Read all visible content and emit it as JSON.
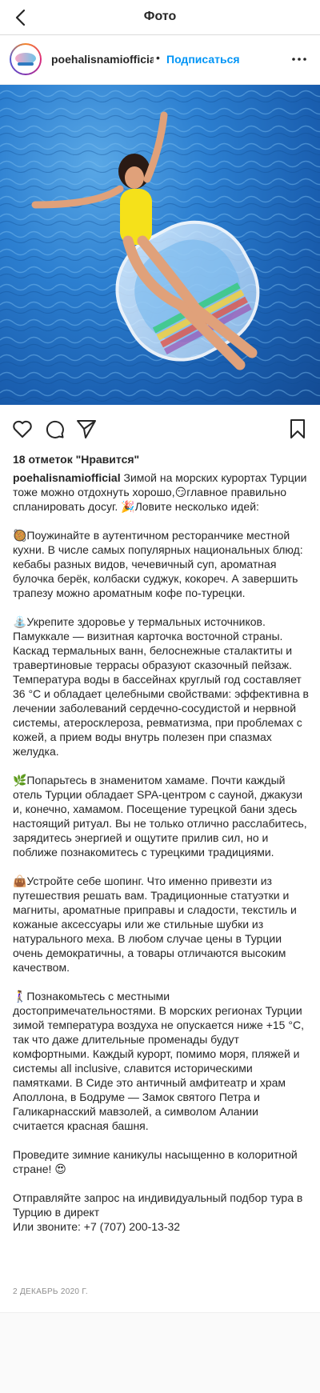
{
  "topbar": {
    "title": "Фото",
    "back_icon": "chevron-left-icon"
  },
  "post_header": {
    "username": "poehalisnamiofficial",
    "separator": "•",
    "follow_label": "Подписаться",
    "more_icon": "more-horizontal-icon"
  },
  "post_image": {
    "alt": "photo"
  },
  "actions": {
    "like_icon": "heart-icon",
    "comment_icon": "comment-icon",
    "share_icon": "paper-plane-icon",
    "save_icon": "bookmark-icon"
  },
  "likes": "18 отметок \"Нравится\"",
  "caption": {
    "username": "poehalisnamiofficial",
    "intro": "Зимой на морских курортах Турции тоже можно отдохнуть хорошо,😏главное правильно спланировать досуг. 🎉Ловите несколько идей:",
    "p1": "🥘Поужинайте в аутентичном ресторанчике местной кухни. В числе самых популярных национальных блюд: кебабы разных видов, чечевичный суп, ароматная булочка берёк, колбаски суджук, кокореч. А завершить трапезу можно ароматным кофе по-турецки.",
    "p2": "⛲Укрепите здоровье у термальных источников. Памуккале — визитная карточка восточной страны. Каскад термальных ванн, белоснежные сталактиты и травертиновые террасы образуют сказочный пейзаж. Температура воды в бассейнах круглый год составляет 36 °С и обладает целебными свойствами: эффективна в лечении заболеваний сердечно-сосудистой и нервной системы, атеросклероза, ревматизма, при проблемах с кожей, а прием воды внутрь полезен при спазмах желудка.",
    "p3": "🌿Попарьтесь в знаменитом хамаме. Почти каждый отель Турции обладает SPA-центром с сауной, джакузи и, конечно, хамамом. Посещение турецкой бани здесь настоящий ритуал. Вы не только отлично расслабитесь, зарядитесь энергией и ощутите прилив сил, но и поближе познакомитесь с турецкими традициями.",
    "p4": "👜Устройте себе шопинг. Что именно привезти из путешествия решать вам. Традиционные статуэтки и магниты, ароматные приправы и сладости, текстиль и кожаные аксессуары или же стильные шубки из натурального меха. В любом случае цены в Турции очень демократичны, а товары отличаются высоким качеством.",
    "p5": "🚶‍♀️Познакомьтесь с местными достопримечательностями. В морских регионах Турции зимой температура воздуха не опускается ниже +15 °С, так что даже длительные променады будут комфортными. Каждый курорт, помимо моря, пляжей и системы all inclusive, славится историческими памятками. В Сиде это античный амфитеатр и храм Аполлона, в Бодруме — Замок святого Петра и Галикарнасский мавзолей, а символом Алании считается красная башня.",
    "p6": "Проведите зимние каникулы насыщенно в колоритной стране! 😍",
    "p7_line1": "Отправляйте запрос на индивидуальный подбор тура в Турцию в директ",
    "p7_line2": "Или звоните: +7 (707) 200-13-32"
  },
  "date": "2 декабрь 2020 г.",
  "colors": {
    "link": "#0095f6",
    "text": "#262626",
    "muted": "#8e8e8e",
    "border": "#dbdbdb"
  }
}
